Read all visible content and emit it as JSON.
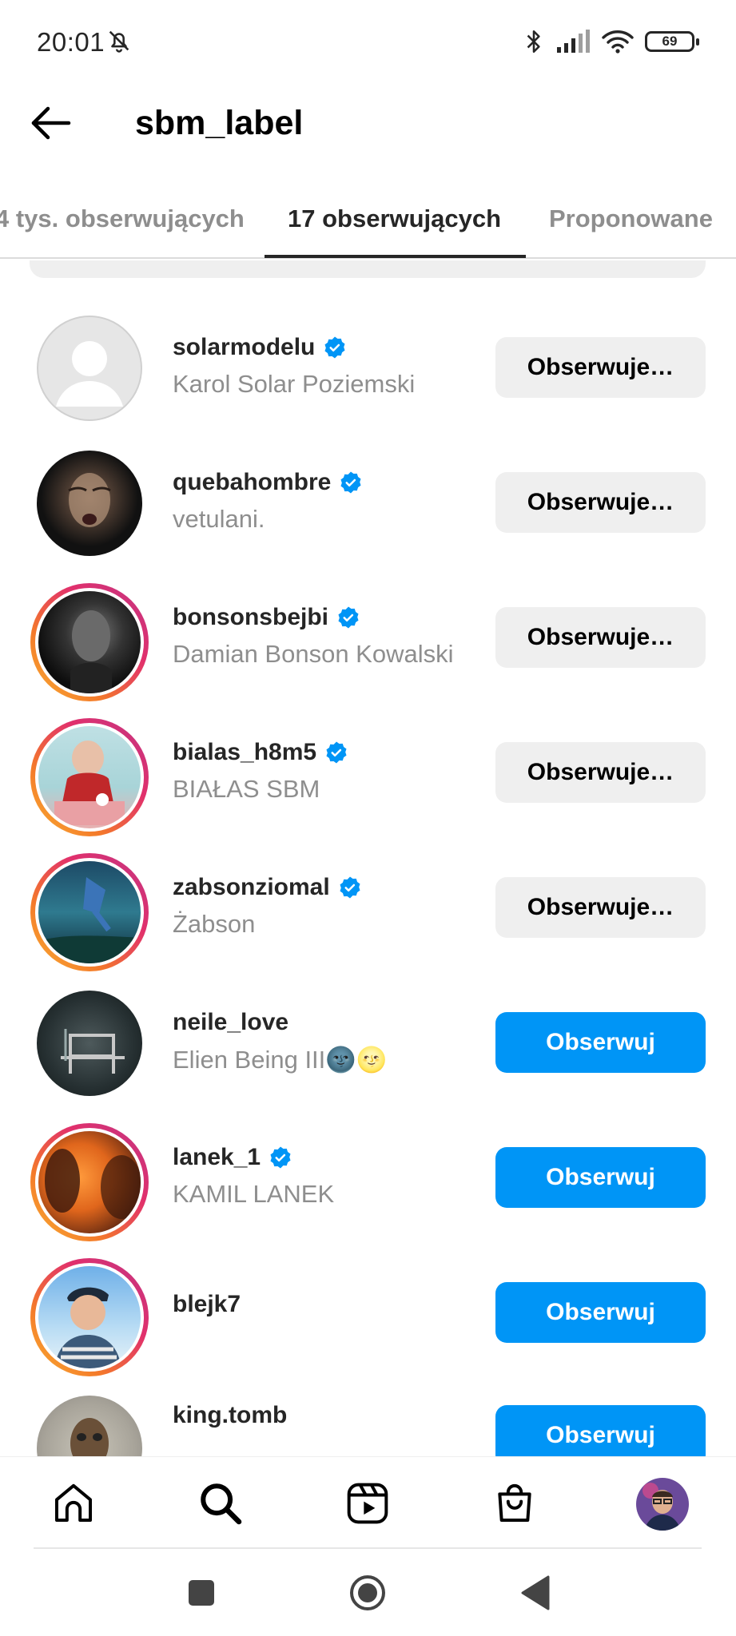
{
  "status_bar": {
    "time": "20:01",
    "battery": "69",
    "icons": [
      "mute-bell-icon",
      "bluetooth-icon",
      "signal-icon",
      "wifi-icon",
      "battery-icon"
    ]
  },
  "header": {
    "title": "sbm_label",
    "back_icon": "arrow-left-icon"
  },
  "tabs": [
    {
      "label": "4 tys. obserwujących",
      "active": false
    },
    {
      "label": "17 obserwujących",
      "active": true
    },
    {
      "label": "Proponowane",
      "active": false
    }
  ],
  "accounts": [
    {
      "username": "solarmodelu",
      "name": "Karol Solar Poziemski",
      "verified": true,
      "story": false,
      "button": "Obserwuje…",
      "following": true
    },
    {
      "username": "quebahombre",
      "name": "vetulani.",
      "verified": true,
      "story": false,
      "button": "Obserwuje…",
      "following": true
    },
    {
      "username": "bonsonsbejbi",
      "name": "Damian Bonson Kowalski",
      "verified": true,
      "story": true,
      "button": "Obserwuje…",
      "following": true
    },
    {
      "username": "bialas_h8m5",
      "name": "BIAŁAS SBM",
      "verified": true,
      "story": true,
      "button": "Obserwuje…",
      "following": true
    },
    {
      "username": "zabsonziomal",
      "name": "Żabson",
      "verified": true,
      "story": true,
      "button": "Obserwuje…",
      "following": true
    },
    {
      "username": "neile_love",
      "name": "Elien Being III🌚🌝",
      "verified": false,
      "story": false,
      "button": "Obserwuj",
      "following": false
    },
    {
      "username": "lanek_1",
      "name": "KAMIL LANEK",
      "verified": true,
      "story": true,
      "button": "Obserwuj",
      "following": false
    },
    {
      "username": "blejk7",
      "name": "",
      "verified": false,
      "story": true,
      "button": "Obserwuj",
      "following": false
    },
    {
      "username": "king.tomb",
      "name": "",
      "verified": false,
      "story": false,
      "button": "Obserwuj",
      "following": false
    }
  ],
  "bottom_nav": [
    "home-icon",
    "search-icon",
    "reels-icon",
    "shop-icon",
    "profile-avatar"
  ],
  "system_nav": [
    "recents-square-icon",
    "home-circle-icon",
    "back-triangle-icon"
  ],
  "colors": {
    "follow_blue": "#0095f6",
    "following_gray": "#efefef",
    "verified_blue": "#0095f6",
    "secondary_text": "#8e8e8e"
  }
}
